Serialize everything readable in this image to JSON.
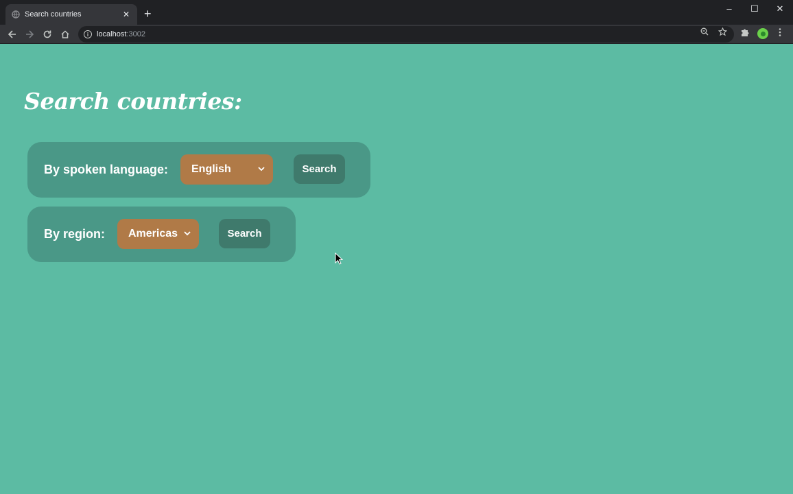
{
  "browser": {
    "tab_title": "Search countries",
    "tab_close": "✕",
    "new_tab": "+",
    "url_host": "localhost",
    "url_port": ":3002",
    "window_controls": [
      "–",
      "☐",
      "✕"
    ]
  },
  "page": {
    "title": "Search countries:",
    "language_search": {
      "label": "By spoken language:",
      "selected": "English",
      "button": "Search"
    },
    "region_search": {
      "label": "By region:",
      "selected": "Americas",
      "button": "Search"
    }
  },
  "colors": {
    "background": "#5cbba3",
    "card": "#4a9887",
    "select": "#b07a47",
    "button": "#3f7a6c"
  }
}
